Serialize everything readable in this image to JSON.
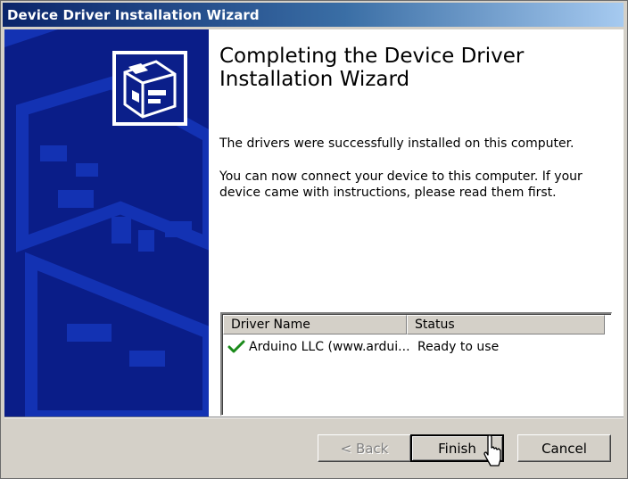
{
  "window": {
    "title": "Device Driver Installation Wizard"
  },
  "content": {
    "heading": "Completing the Device Driver Installation Wizard",
    "message1": "The drivers were successfully installed on this computer.",
    "message2": "You can now connect your device to this computer. If your device came with instructions, please read them first."
  },
  "driver_list": {
    "columns": [
      "Driver Name",
      "Status"
    ],
    "rows": [
      {
        "icon": "check-icon",
        "name": "Arduino LLC (www.ardui...",
        "status": "Ready to use"
      }
    ]
  },
  "buttons": {
    "back": "< Back",
    "finish": "Finish",
    "cancel": "Cancel"
  },
  "colors": {
    "title_bar_start": "#0a246a",
    "side_panel": "#0a1d88",
    "check": "#1a8a1a"
  }
}
